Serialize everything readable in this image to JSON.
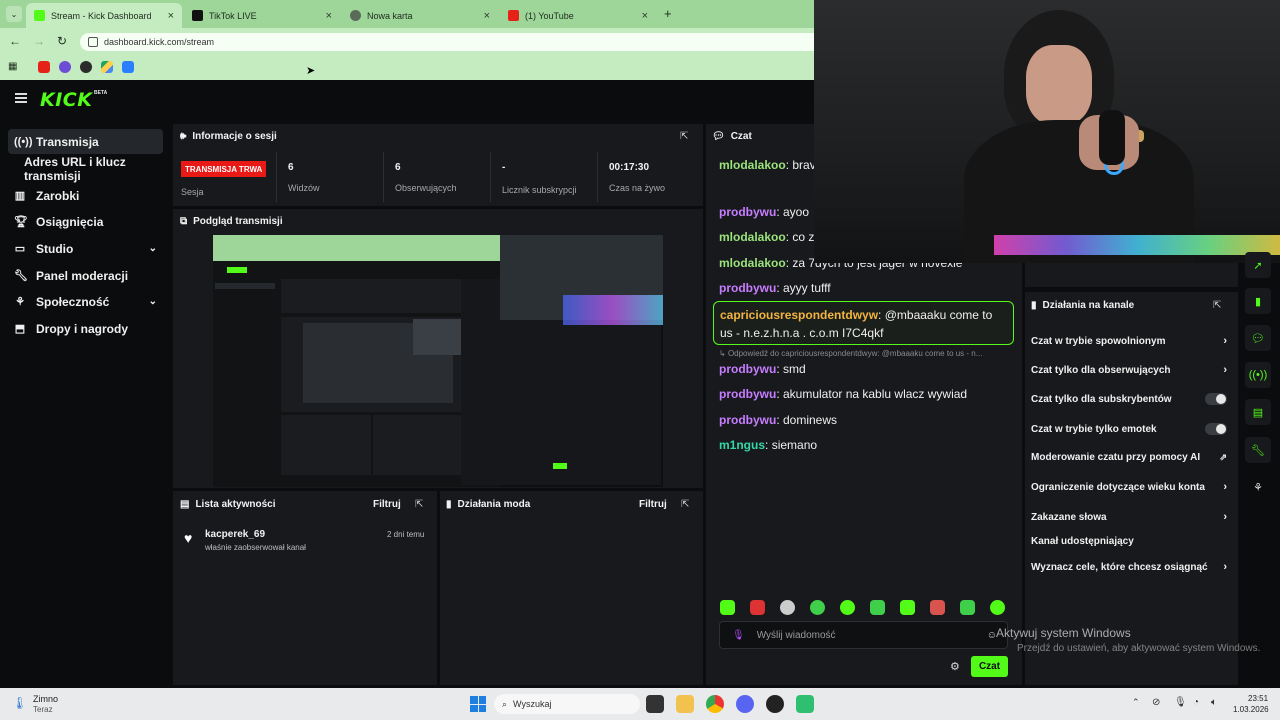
{
  "browser": {
    "tabs": [
      {
        "label": "Stream - Kick Dashboard"
      },
      {
        "label": "TikTok LIVE"
      },
      {
        "label": "Nowa karta"
      },
      {
        "label": "(1) YouTube"
      }
    ],
    "new_tab": "+",
    "url": "dashboard.kick.com/stream"
  },
  "kick": {
    "logo": "KICK",
    "beta": "BETA"
  },
  "sidebar": {
    "items": [
      {
        "label": "Transmisja"
      },
      {
        "label": "Adres URL i klucz transmisji"
      },
      {
        "label": "Zarobki"
      },
      {
        "label": "Osiągnięcia"
      },
      {
        "label": "Studio"
      },
      {
        "label": "Panel moderacji"
      },
      {
        "label": "Społeczność"
      },
      {
        "label": "Dropy i nagrody"
      }
    ]
  },
  "session": {
    "title": "Informacje o sesji",
    "live_badge": "TRANSMISJA TRWA",
    "session_label": "Sesja",
    "stats": [
      {
        "value": "6",
        "label": "Widzów"
      },
      {
        "value": "6",
        "label": "Obserwujących"
      },
      {
        "value": "-",
        "label": "Licznik subskrypcji"
      },
      {
        "value": "00:17:30",
        "label": "Czas na żywo"
      }
    ]
  },
  "preview": {
    "title": "Podgląd transmisji"
  },
  "activity": {
    "title": "Lista aktywności",
    "filter": "Filtruj",
    "entries": [
      {
        "user": "kacperek_69",
        "action": "właśnie zaobserwował kanał",
        "time": "2 dni temu"
      }
    ]
  },
  "mod_actions": {
    "title": "Działania moda",
    "filter": "Filtruj"
  },
  "chat": {
    "title": "Czat",
    "messages": [
      {
        "user": "mlodalakoo",
        "text": "brav",
        "color": "#9be37a"
      },
      {
        "user": "prodbywu",
        "text": "ayoo",
        "color": "#c77dff"
      },
      {
        "user": "mlodalakoo",
        "text": "co z",
        "color": "#9be37a"
      },
      {
        "user": "mlodalakoo",
        "text": "za 7dych to jest jager w novexie",
        "color": "#9be37a"
      },
      {
        "user": "prodbywu",
        "text": "ayyy tufff",
        "color": "#c77dff"
      },
      {
        "user": "capriciousrespondentdwyw",
        "text": "@mbaaaku come to us - n.e.z.h.n.a . c.o.m I7C4qkf",
        "color": "#f2b441"
      },
      {
        "user": "prodbywu",
        "text": "smd",
        "color": "#c77dff"
      },
      {
        "user": "prodbywu",
        "text": "akumulator na kablu wlacz wywiad",
        "color": "#c77dff"
      },
      {
        "user": "prodbywu",
        "text": "dominews",
        "color": "#c77dff"
      },
      {
        "user": "m1ngus",
        "text": "siemano",
        "color": "#35d6a8"
      }
    ],
    "reply_hint": "Odpowiedź do capriciousrespondentdwyw: @mbaaaku come to us - n...",
    "input_placeholder": "Wyślij wiadomość",
    "send_label": "Czat"
  },
  "channel_actions": {
    "title": "Działania na kanale",
    "items": [
      {
        "label": "Czat w trybie spowolnionym"
      },
      {
        "label": "Czat tylko dla obserwujących"
      },
      {
        "label": "Czat tylko dla subskrybentów"
      },
      {
        "label": "Czat w trybie tylko emotek"
      },
      {
        "label": "Moderowanie czatu przy pomocy AI"
      },
      {
        "label": "Ograniczenie dotyczące wieku konta"
      },
      {
        "label": "Zakazane słowa"
      },
      {
        "label": "Kanał udostępniający"
      },
      {
        "label": "Wyznacz cele, które chcesz osiągnąć"
      }
    ]
  },
  "watermark": {
    "line1": "Aktywuj system Windows",
    "line2": "Przejdź do ustawień, aby aktywować system Windows."
  },
  "taskbar": {
    "weather_title": "Zimno",
    "weather_sub": "Teraz",
    "search_placeholder": "Wyszukaj",
    "time": "23:51",
    "date": "1.03.2026"
  },
  "colors": {
    "accent": "#53fc18",
    "live_red": "#e91916"
  }
}
